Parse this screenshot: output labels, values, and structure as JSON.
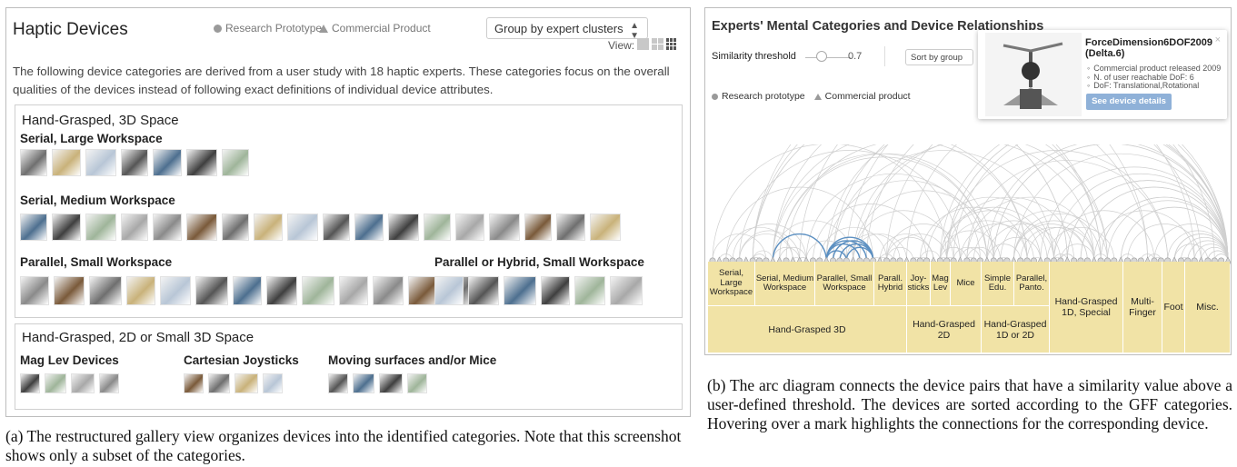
{
  "gallery": {
    "title": "Haptic Devices",
    "legend_research": "Research Prototype",
    "legend_commercial": "Commercial Product",
    "group_select_value": "Group by expert clusters",
    "view_label": "View:",
    "intro": "The following device categories are derived from a user study with 18 haptic experts. These categories focus on the overall qualities of the devices instead of following exact definitions of individual device attributes.",
    "categories": [
      {
        "title": "Hand-Grasped, 3D Space",
        "subgroups": [
          {
            "title": "Serial, Large Workspace",
            "device_count": 7
          },
          {
            "title": "Serial, Medium Workspace",
            "device_count": 18
          },
          {
            "title": "Parallel, Small Workspace",
            "device_count": 13
          },
          {
            "title": "Parallel or Hybrid, Small Workspace",
            "device_count": 6
          }
        ]
      },
      {
        "title": "Hand-Grasped, 2D or Small 3D Space",
        "subgroups": [
          {
            "title": "Mag Lev Devices",
            "device_count": 4
          },
          {
            "title": "Cartesian Joysticks",
            "device_count": 4
          },
          {
            "title": "Moving surfaces and/or Mice",
            "device_count": 4
          }
        ]
      }
    ],
    "caption": "(a) The restructured gallery view organizes devices into the identified categories. Note that this screenshot shows only a subset of the categories."
  },
  "arc_view": {
    "title": "Experts' Mental Categories and Device Relationships",
    "similarity_label": "Similarity threshold",
    "similarity_value": "0.7",
    "sort_value": "Sort by group",
    "legend_research": "Research prototype",
    "legend_commercial": "Commercial product",
    "tooltip": {
      "name": "ForceDimension6DOF2009 (Delta.6)",
      "details": [
        "Commercial product released 2009",
        "N. of user reachable DoF: 6",
        "DoF: Translational,Rotational"
      ],
      "button": "See device details",
      "close": "×"
    },
    "top_categories": [
      "Serial, Large Workspace",
      "Serial, Medium Workspace",
      "Parallel, Small Workspace",
      "Parall. Hybrid",
      "Joy-sticks",
      "Mag Lev",
      "Mice",
      "Simple Edu.",
      "Parallel, Panto."
    ],
    "bottom_categories": [
      "Hand-Grasped 3D",
      "Hand-Grasped 2D",
      "Hand-Grasped 1D or 2D"
    ],
    "full_categories": [
      "Hand-Grasped 1D, Special",
      "Multi-Finger",
      "Foot",
      "Misc."
    ],
    "highlight_color": "#5b8fc1",
    "arc_color": "#cfcfcf",
    "category_color": "#f1e3a6",
    "caption": "(b) The arc diagram connects the device pairs that have a similarity value above a user-defined threshold. The devices are sorted according to the GFF categories. Hovering over a mark highlights the connections for the corresponding device."
  }
}
